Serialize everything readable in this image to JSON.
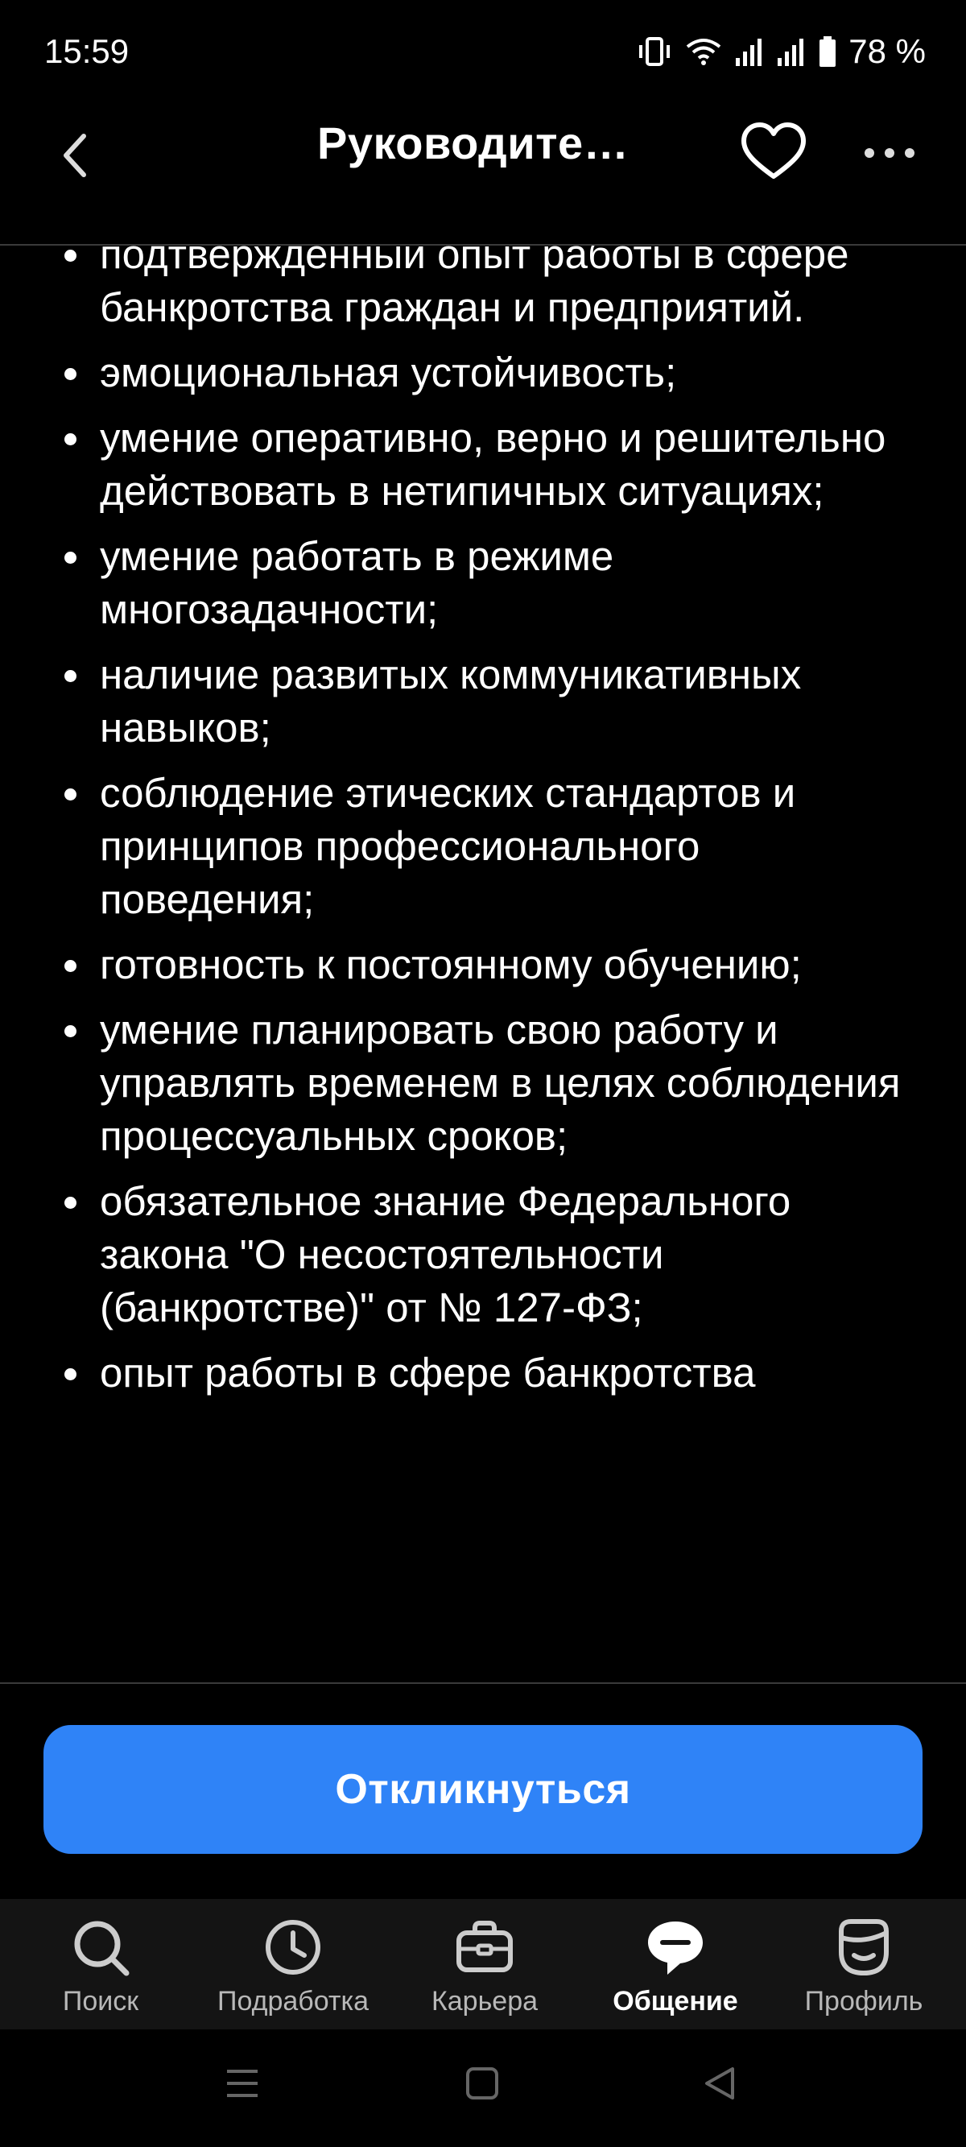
{
  "status": {
    "time": "15:59",
    "battery": "78 %"
  },
  "header": {
    "title": "Руководите…",
    "icons": {
      "back": "chevron-left-icon",
      "favorite": "heart-icon",
      "more": "more-dots-icon"
    }
  },
  "content": {
    "items": [
      "подтвержденный опыт работы в сфере банкротства граждан и предприятий.",
      "эмоциональная устойчивость;",
      "умение оперативно, верно и решительно действовать в нетипичных ситуациях;",
      "умение работать в режиме многозадачности;",
      "наличие развитых коммуникативных навыков;",
      "соблюдение этических стандартов и принципов профессионального поведения;",
      "готовность к постоянному обучению;",
      "умение планировать свою работу и управлять временем в целях соблюдения процессуальных сроков;",
      "обязательное знание Федерального закона \"О несостоятельности (банкротстве)\" от № 127-ФЗ;",
      "опыт работы в сфере банкротства"
    ]
  },
  "apply_button": {
    "label": "Откликнуться",
    "color": "#2f83f7"
  },
  "bottom_nav": {
    "items": [
      {
        "label": "Поиск",
        "icon": "search-icon"
      },
      {
        "label": "Подработка",
        "icon": "clock-icon"
      },
      {
        "label": "Карьера",
        "icon": "briefcase-icon"
      },
      {
        "label": "Общение",
        "icon": "chat-icon",
        "active": true
      },
      {
        "label": "Профиль",
        "icon": "profile-icon"
      }
    ]
  }
}
